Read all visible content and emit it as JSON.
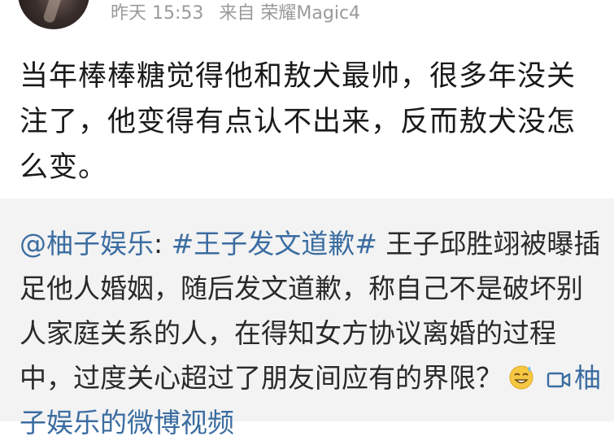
{
  "header": {
    "time": "昨天 15:53",
    "source": "来自 荣耀Magic4"
  },
  "post": {
    "text": "当年棒棒糖觉得他和敖犬最帅，很多年没关注了，他变得有点认不出来，反而敖犬没怎么变。"
  },
  "repost": {
    "author": "@柚子娱乐",
    "colon": ": ",
    "hashtag": "#王子发文道歉#",
    "body": " 王子邱胜翊被曝插足他人婚姻，随后发文道歉，称自己不是破坏别人家庭关系的人，在得知女方协议离婚的过程中，过度关心超过了朋友间应有的界限？",
    "emoji_icon": "sweat-grin-emoji-icon",
    "video_icon": "video-camera-icon",
    "video_link": "柚子娱乐的微博视频"
  }
}
